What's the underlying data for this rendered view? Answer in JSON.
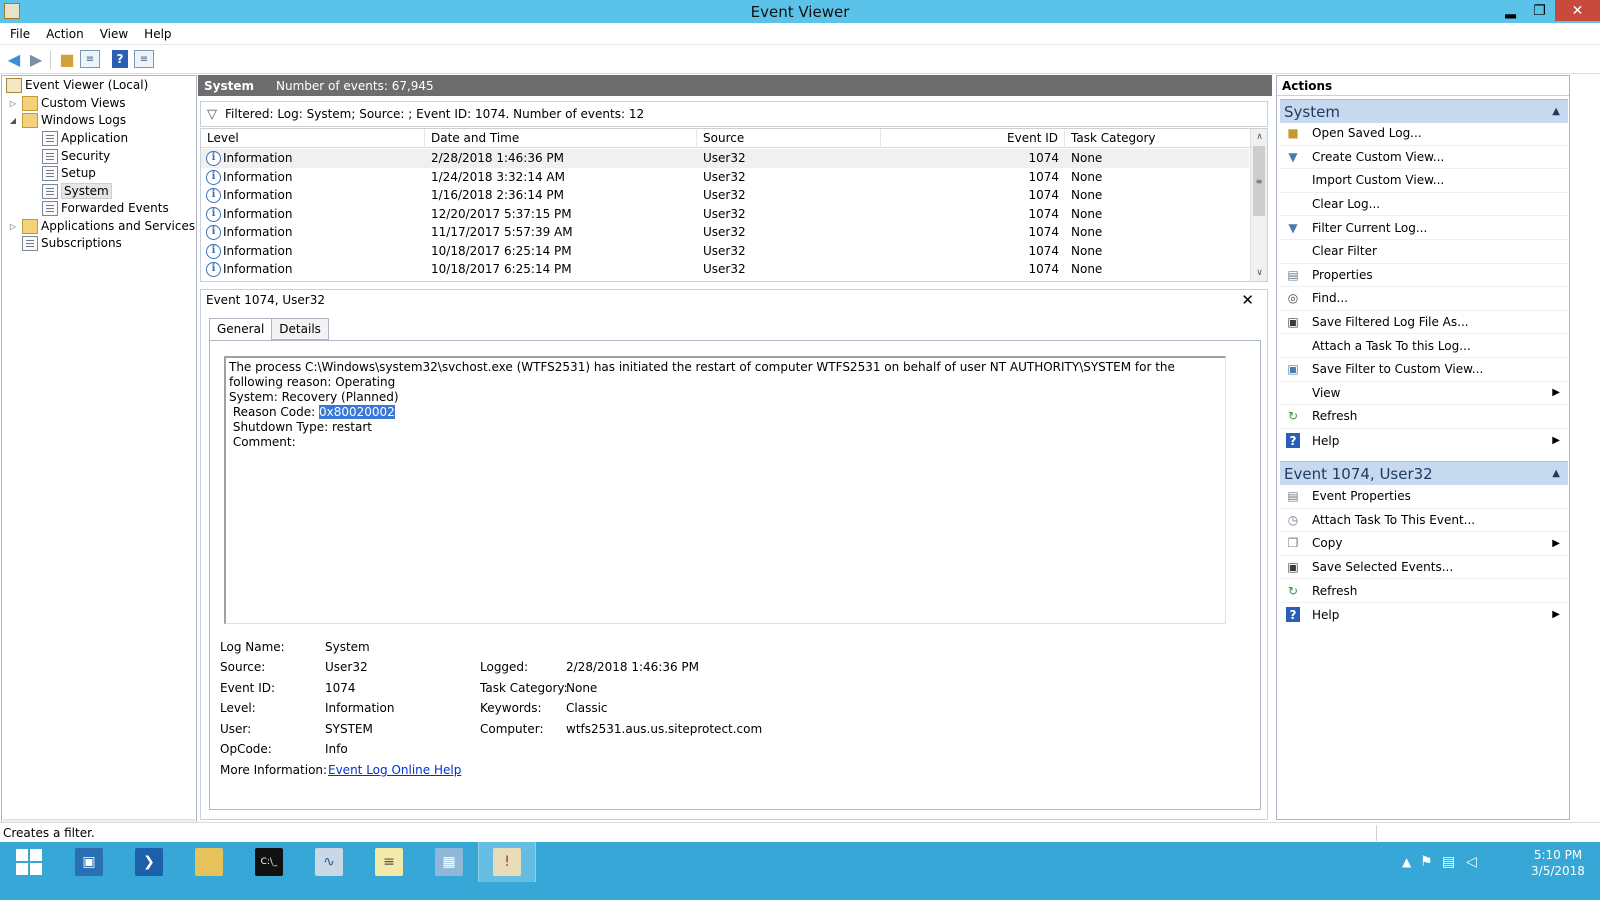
{
  "window": {
    "title": "Event Viewer",
    "min_glyph": "▂",
    "max_glyph": "❐",
    "close_glyph": "✕"
  },
  "menu": [
    "File",
    "Action",
    "View",
    "Help"
  ],
  "tree": {
    "root": "Event Viewer (Local)",
    "custom_views": "Custom Views",
    "windows_logs": "Windows Logs",
    "application": "Application",
    "security": "Security",
    "setup": "Setup",
    "system": "System",
    "forwarded_events": "Forwarded Events",
    "apps_services": "Applications and Services Lo",
    "subscriptions": "Subscriptions"
  },
  "center": {
    "log_name": "System",
    "event_count": "Number of events: 67,945",
    "filter_text": "Filtered: Log: System; Source: ; Event ID: 1074. Number of events: 12"
  },
  "grid": {
    "columns": [
      "Level",
      "Date and Time",
      "Source",
      "Event ID",
      "Task Category"
    ],
    "rows": [
      {
        "level": "Information",
        "datetime": "2/28/2018 1:46:36 PM",
        "source": "User32",
        "event_id": "1074",
        "category": "None"
      },
      {
        "level": "Information",
        "datetime": "1/24/2018 3:32:14 AM",
        "source": "User32",
        "event_id": "1074",
        "category": "None"
      },
      {
        "level": "Information",
        "datetime": "1/16/2018 2:36:14 PM",
        "source": "User32",
        "event_id": "1074",
        "category": "None"
      },
      {
        "level": "Information",
        "datetime": "12/20/2017 5:37:15 PM",
        "source": "User32",
        "event_id": "1074",
        "category": "None"
      },
      {
        "level": "Information",
        "datetime": "11/17/2017 5:57:39 AM",
        "source": "User32",
        "event_id": "1074",
        "category": "None"
      },
      {
        "level": "Information",
        "datetime": "10/18/2017 6:25:14 PM",
        "source": "User32",
        "event_id": "1074",
        "category": "None"
      },
      {
        "level": "Information",
        "datetime": "10/18/2017 6:25:14 PM",
        "source": "User32",
        "event_id": "1074",
        "category": "None"
      }
    ]
  },
  "detail": {
    "title": "Event 1074, User32",
    "tabs": [
      "General",
      "Details"
    ],
    "message_line1": "The process C:\\Windows\\system32\\svchost.exe (WTFS2531) has initiated the restart of computer WTFS2531 on behalf of user NT AUTHORITY\\SYSTEM for the following reason: Operating",
    "message_line2": "System: Recovery (Planned)",
    "reason_label": " Reason Code: ",
    "reason_value": "0x80020002",
    "message_line4": " Shutdown Type: restart",
    "message_line5": " Comment: ",
    "props": {
      "log_name_label": "Log Name:",
      "log_name": "System",
      "source_label": "Source:",
      "source": "User32",
      "logged_label": "Logged:",
      "logged": "2/28/2018 1:46:36 PM",
      "event_id_label": "Event ID:",
      "event_id": "1074",
      "task_category_label": "Task Category:",
      "task_category": "None",
      "level_label": "Level:",
      "level": "Information",
      "keywords_label": "Keywords:",
      "keywords": "Classic",
      "user_label": "User:",
      "user": "SYSTEM",
      "computer_label": "Computer:",
      "computer": "wtfs2531.aus.us.siteprotect.com",
      "opcode_label": "OpCode:",
      "opcode": "Info",
      "more_info_label": "More Information:",
      "more_info_link": "Event Log Online Help"
    }
  },
  "actions": {
    "header": "Actions",
    "section1_title": "System",
    "section1": [
      {
        "label": "Open Saved Log...",
        "icon": "open-log-icon"
      },
      {
        "label": "Create Custom View...",
        "icon": "funnel-icon"
      },
      {
        "label": "Import Custom View...",
        "icon": ""
      },
      {
        "label": "Clear Log...",
        "icon": ""
      },
      {
        "label": "Filter Current Log...",
        "icon": "funnel-icon"
      },
      {
        "label": "Clear Filter",
        "icon": ""
      },
      {
        "label": "Properties",
        "icon": "properties-icon"
      },
      {
        "label": "Find...",
        "icon": "binoculars-icon"
      },
      {
        "label": "Save Filtered Log File As...",
        "icon": "save-icon"
      },
      {
        "label": "Attach a Task To this Log...",
        "icon": ""
      },
      {
        "label": "Save Filter to Custom View...",
        "icon": "save-filter-icon"
      },
      {
        "label": "View",
        "icon": ""
      },
      {
        "label": "Refresh",
        "icon": "refresh-icon"
      },
      {
        "label": "Help",
        "icon": "help-icon"
      }
    ],
    "section2_title": "Event 1074, User32",
    "section2": [
      {
        "label": "Event Properties",
        "icon": "properties-icon"
      },
      {
        "label": "Attach Task To This Event...",
        "icon": "task-icon"
      },
      {
        "label": "Copy",
        "icon": "copy-icon"
      },
      {
        "label": "Save Selected Events...",
        "icon": "save-icon"
      },
      {
        "label": "Refresh",
        "icon": "refresh-icon"
      },
      {
        "label": "Help",
        "icon": "help-icon"
      }
    ]
  },
  "status": {
    "text": "Creates a filter."
  },
  "taskbar": {
    "clock_time": "5:10 PM",
    "clock_date": "3/5/2018"
  }
}
